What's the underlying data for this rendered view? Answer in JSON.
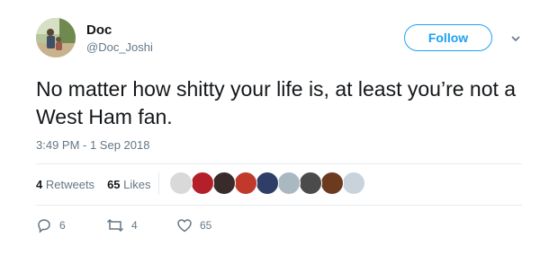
{
  "user": {
    "name": "Doc",
    "handle": "@Doc_Joshi",
    "avatar_icon": "profile-photo"
  },
  "follow_button": {
    "label": "Follow"
  },
  "menu_icon": "chevron-down-icon",
  "tweet": {
    "text": "No matter how shitty your life is, at least you’re not a West Ham fan.",
    "timestamp": "3:49 PM - 1 Sep 2018"
  },
  "stats": {
    "retweets_count": "4",
    "retweets_label": "Retweets",
    "likes_count": "65",
    "likes_label": "Likes"
  },
  "likers": [
    {
      "color": "#d9d9d9"
    },
    {
      "color": "#b3202a"
    },
    {
      "color": "#3a2b2b"
    },
    {
      "color": "#c0392b"
    },
    {
      "color": "#2f3e66"
    },
    {
      "color": "#aab8c2"
    },
    {
      "color": "#4b4b4b"
    },
    {
      "color": "#6b3a1f"
    },
    {
      "color": "#c9d3dc"
    }
  ],
  "actions": {
    "reply_count": "6",
    "retweet_count": "4",
    "like_count": "65"
  },
  "colors": {
    "accent": "#1da1f2",
    "text": "#14171a",
    "muted": "#657786",
    "divider": "#e6ecf0"
  }
}
